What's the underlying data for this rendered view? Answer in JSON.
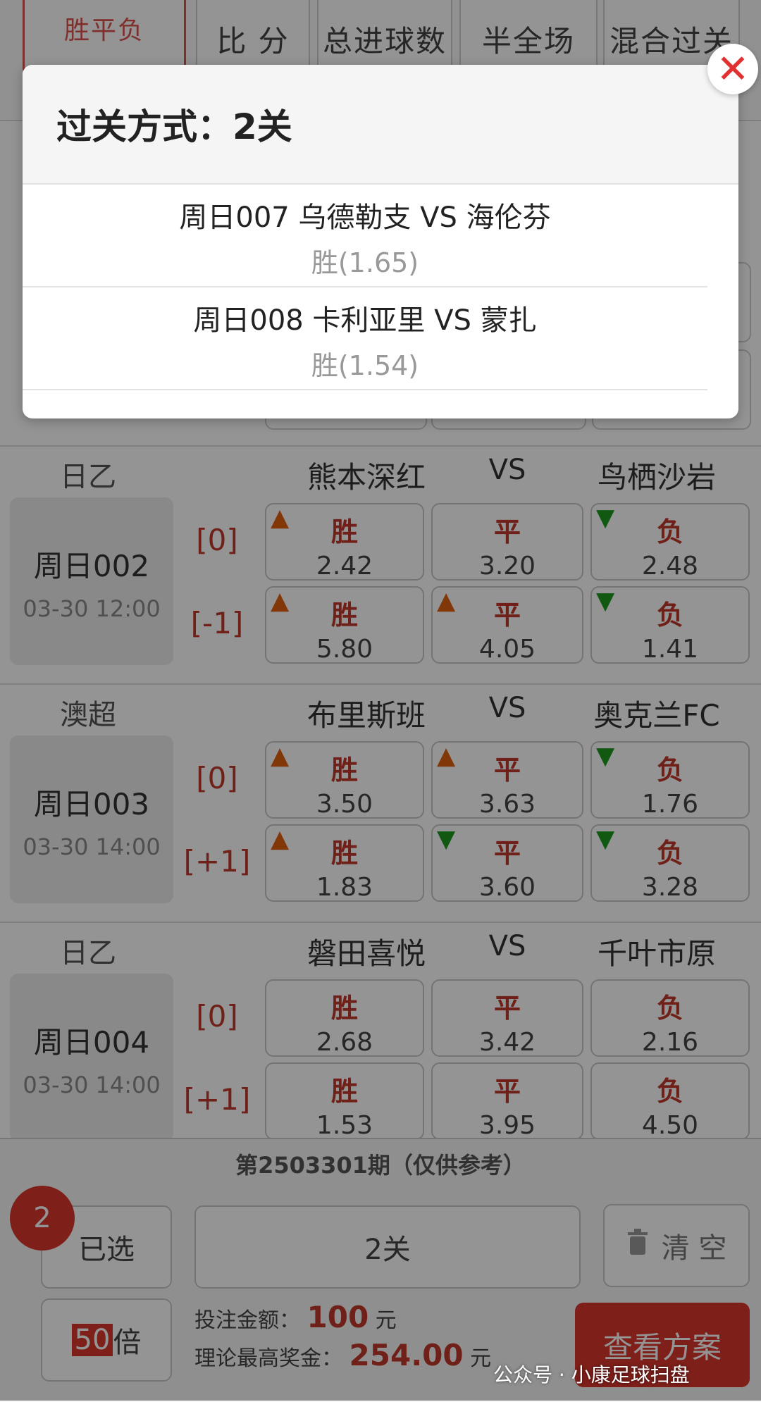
{
  "tabs": [
    {
      "label": "胜平负"
    },
    {
      "label": "比 分"
    },
    {
      "label": "总进球数"
    },
    {
      "label": "半全场"
    },
    {
      "label": "混合过关"
    }
  ],
  "modal": {
    "title": "过关方式：2关",
    "items": [
      {
        "title": "周日007 乌德勒支 VS 海伦芬",
        "selection": "胜(1.65)"
      },
      {
        "title": "周日008 卡利亚里 VS 蒙扎",
        "selection": "胜(1.54)"
      }
    ],
    "close_icon": "close-icon"
  },
  "matches": [
    {
      "league": "日乙",
      "home": "熊本深红",
      "vs": "VS",
      "away": "鸟栖沙岩",
      "num": "周日002",
      "time": "03-30 12:00",
      "rows": [
        {
          "handicap": "[0]",
          "odds": [
            {
              "res": "胜",
              "val": "2.42",
              "trend": "up"
            },
            {
              "res": "平",
              "val": "3.20",
              "trend": ""
            },
            {
              "res": "负",
              "val": "2.48",
              "trend": "down"
            }
          ]
        },
        {
          "handicap": "[-1]",
          "odds": [
            {
              "res": "胜",
              "val": "5.80",
              "trend": "up"
            },
            {
              "res": "平",
              "val": "4.05",
              "trend": "up"
            },
            {
              "res": "负",
              "val": "1.41",
              "trend": "down"
            }
          ]
        }
      ]
    },
    {
      "league": "澳超",
      "home": "布里斯班",
      "vs": "VS",
      "away": "奥克兰FC",
      "num": "周日003",
      "time": "03-30 14:00",
      "rows": [
        {
          "handicap": "[0]",
          "odds": [
            {
              "res": "胜",
              "val": "3.50",
              "trend": "up"
            },
            {
              "res": "平",
              "val": "3.63",
              "trend": "up"
            },
            {
              "res": "负",
              "val": "1.76",
              "trend": "down"
            }
          ]
        },
        {
          "handicap": "[+1]",
          "odds": [
            {
              "res": "胜",
              "val": "1.83",
              "trend": "up"
            },
            {
              "res": "平",
              "val": "3.60",
              "trend": "down"
            },
            {
              "res": "负",
              "val": "3.28",
              "trend": "down"
            }
          ]
        }
      ]
    },
    {
      "league": "日乙",
      "home": "磐田喜悦",
      "vs": "VS",
      "away": "千叶市原",
      "num": "周日004",
      "time": "03-30 14:00",
      "rows": [
        {
          "handicap": "[0]",
          "odds": [
            {
              "res": "胜",
              "val": "2.68",
              "trend": ""
            },
            {
              "res": "平",
              "val": "3.42",
              "trend": ""
            },
            {
              "res": "负",
              "val": "2.16",
              "trend": ""
            }
          ]
        },
        {
          "handicap": "[+1]",
          "odds": [
            {
              "res": "胜",
              "val": "1.53",
              "trend": ""
            },
            {
              "res": "平",
              "val": "3.95",
              "trend": ""
            },
            {
              "res": "负",
              "val": "4.50",
              "trend": ""
            }
          ]
        }
      ]
    }
  ],
  "bottom": {
    "period": "第2503301期（仅供参考）",
    "badge_count": "2",
    "selected_label": "已选",
    "pass_label": "2关",
    "clear_label": "清 空",
    "multiple_value": "50",
    "multiple_unit": "倍",
    "stake_label": "投注金额：",
    "stake_value": "100",
    "stake_unit": "元",
    "max_prize_label": "理论最高奖金：",
    "max_prize_value": "254.00",
    "max_prize_unit": "元",
    "view_plan_label": "查看方案"
  },
  "watermark": "公众号 · 小康足球扫盘",
  "colors": {
    "accent": "#d9362c",
    "up": "#e06010",
    "down": "#1e9a1e"
  }
}
